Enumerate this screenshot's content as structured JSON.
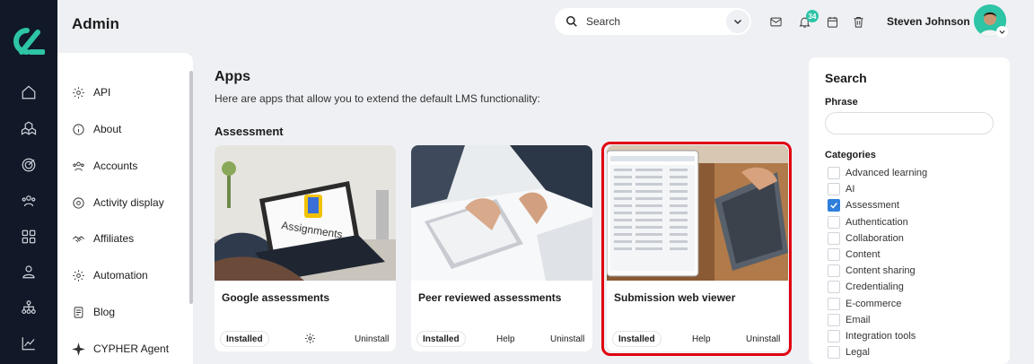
{
  "header": {
    "title": "Admin",
    "search_placeholder": "Search",
    "notification_count": "34",
    "user_name": "Steven Johnson"
  },
  "sidebar": {
    "items": [
      {
        "label": "API",
        "icon": "gear-icon"
      },
      {
        "label": "About",
        "icon": "info-icon"
      },
      {
        "label": "Accounts",
        "icon": "users-icon"
      },
      {
        "label": "Activity display",
        "icon": "activity-icon"
      },
      {
        "label": "Affiliates",
        "icon": "handshake-icon"
      },
      {
        "label": "Automation",
        "icon": "gear-icon"
      },
      {
        "label": "Blog",
        "icon": "blog-icon"
      },
      {
        "label": "CYPHER Agent",
        "icon": "sparkle-icon"
      }
    ]
  },
  "main": {
    "title": "Apps",
    "description": "Here are apps that allow you to extend the default LMS functionality:",
    "section": "Assessment",
    "cards": [
      {
        "name": "Google assessments",
        "status": "Installed",
        "middle_action": "settings-icon",
        "right_action": "Uninstall",
        "image_text": "Assignments"
      },
      {
        "name": "Peer reviewed assessments",
        "status": "Installed",
        "middle_action": "Help",
        "right_action": "Uninstall"
      },
      {
        "name": "Submission web viewer",
        "status": "Installed",
        "middle_action": "Help",
        "right_action": "Uninstall"
      }
    ]
  },
  "filters": {
    "title": "Search",
    "phrase_label": "Phrase",
    "phrase_value": "",
    "categories_label": "Categories",
    "categories": [
      {
        "label": "Advanced learning",
        "checked": false
      },
      {
        "label": "AI",
        "checked": false
      },
      {
        "label": "Assessment",
        "checked": true
      },
      {
        "label": "Authentication",
        "checked": false
      },
      {
        "label": "Collaboration",
        "checked": false
      },
      {
        "label": "Content",
        "checked": false
      },
      {
        "label": "Content sharing",
        "checked": false
      },
      {
        "label": "Credentialing",
        "checked": false
      },
      {
        "label": "E-commerce",
        "checked": false
      },
      {
        "label": "Email",
        "checked": false
      },
      {
        "label": "Integration tools",
        "checked": false
      },
      {
        "label": "Legal",
        "checked": false
      }
    ]
  },
  "colors": {
    "accent": "#2ec4a6",
    "rail": "#111827",
    "highlight": "#e10010",
    "checkbox": "#2f7fdc"
  }
}
